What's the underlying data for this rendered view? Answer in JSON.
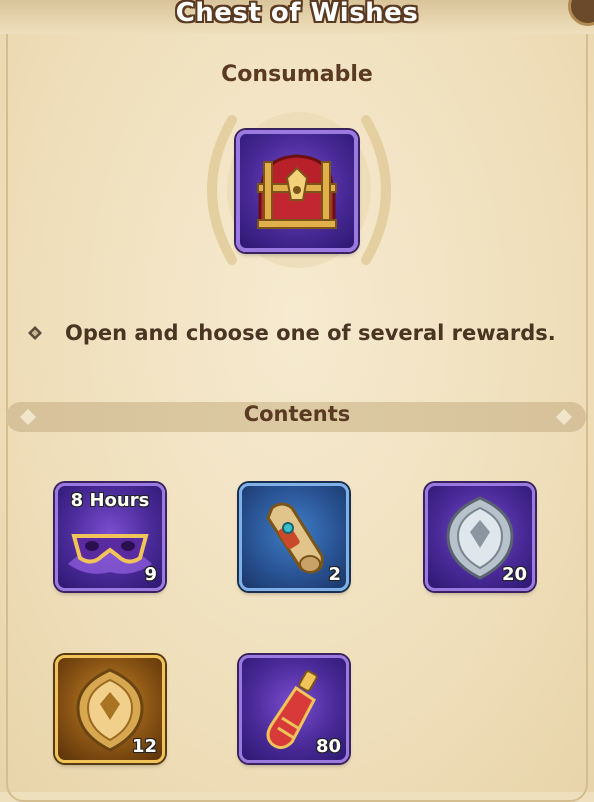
{
  "header": {
    "title": "Chest of Wishes"
  },
  "item": {
    "type": "Consumable",
    "icon": "treasure-chest-icon"
  },
  "description": {
    "text": "Open and choose one of several rewards."
  },
  "contents": {
    "label": "Contents",
    "rewards": [
      {
        "icon": "mask-icon",
        "rarity": "epic",
        "tag": "8 Hours",
        "count": "9"
      },
      {
        "icon": "scroll-icon",
        "rarity": "rare",
        "count": "2"
      },
      {
        "icon": "silver-emblem-icon",
        "rarity": "epic",
        "count": "20"
      },
      {
        "icon": "gold-emblem-icon",
        "rarity": "legendary",
        "count": "12"
      },
      {
        "icon": "potion-icon",
        "rarity": "epic",
        "count": "80"
      }
    ]
  },
  "colors": {
    "epic": "#4a2a98",
    "rare": "#2a5596",
    "legendary": "#c98a2a",
    "text": "#4a3422"
  }
}
